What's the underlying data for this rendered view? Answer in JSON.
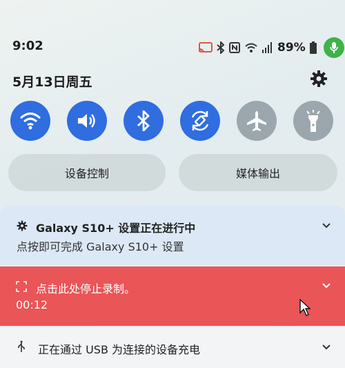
{
  "status_bar": {
    "time": "9:02",
    "battery_percent": "89%",
    "icons": [
      "cast-icon",
      "bluetooth-icon",
      "nfc-icon",
      "wifi-signal-icon",
      "cell-signal-icon",
      "battery-icon",
      "mic-active-icon"
    ]
  },
  "header": {
    "date": "5月13日周五"
  },
  "quick_tiles": [
    {
      "name": "wifi",
      "state": "on"
    },
    {
      "name": "sound",
      "state": "on"
    },
    {
      "name": "bluetooth",
      "state": "on"
    },
    {
      "name": "auto-rotate",
      "state": "on"
    },
    {
      "name": "airplane-mode",
      "state": "off"
    },
    {
      "name": "flashlight",
      "state": "off"
    }
  ],
  "pills": {
    "device_control": "设备控制",
    "media_output": "媒体输出"
  },
  "notifications": {
    "setup": {
      "title": "Galaxy S10+ 设置正在进行中",
      "subtitle": "点按即可完成 Galaxy S10+ 设置"
    },
    "recording": {
      "title": "点击此处停止录制。",
      "timer": "00:12"
    },
    "usb": {
      "title": "正在通过 USB 为连接的设备充电"
    }
  },
  "colors": {
    "accent": "#2f6de0",
    "tile_off": "#9ba7ac",
    "recording_bg": "#ea5557",
    "mic_green": "#3fb24a"
  }
}
